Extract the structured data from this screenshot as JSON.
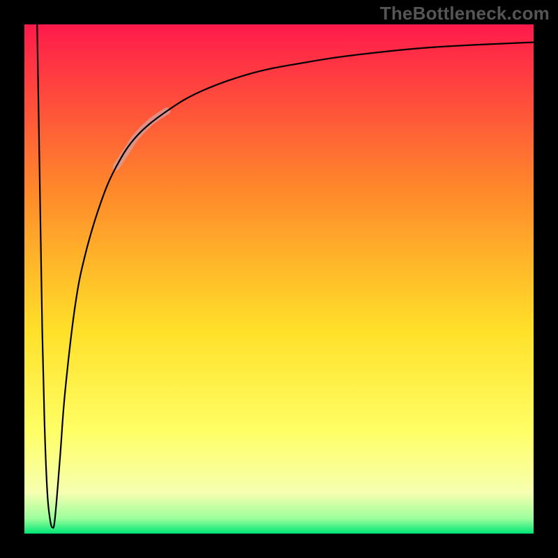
{
  "watermark": "TheBottleneck.com",
  "chart_data": {
    "type": "line",
    "title": "",
    "xlabel": "",
    "ylabel": "",
    "xlim": [
      0,
      100
    ],
    "ylim": [
      0,
      100
    ],
    "background_gradient": {
      "direction": "vertical",
      "stops": [
        {
          "offset": 0.0,
          "color": "#ff1a4b"
        },
        {
          "offset": 0.33,
          "color": "#ff8a2a"
        },
        {
          "offset": 0.6,
          "color": "#ffe029"
        },
        {
          "offset": 0.8,
          "color": "#ffff66"
        },
        {
          "offset": 0.92,
          "color": "#f6ffb0"
        },
        {
          "offset": 0.97,
          "color": "#9cff9c"
        },
        {
          "offset": 1.0,
          "color": "#00e676"
        }
      ]
    },
    "series": [
      {
        "name": "bottleneck-curve",
        "color": "#000000",
        "stroke_width": 2.2,
        "points": [
          {
            "x": 2.5,
            "y": 100.0
          },
          {
            "x": 3.0,
            "y": 70.0
          },
          {
            "x": 3.5,
            "y": 40.0
          },
          {
            "x": 4.0,
            "y": 20.0
          },
          {
            "x": 4.5,
            "y": 8.0
          },
          {
            "x": 5.0,
            "y": 3.0
          },
          {
            "x": 5.5,
            "y": 1.2
          },
          {
            "x": 6.0,
            "y": 3.0
          },
          {
            "x": 7.0,
            "y": 15.0
          },
          {
            "x": 8.0,
            "y": 28.0
          },
          {
            "x": 10.0,
            "y": 45.0
          },
          {
            "x": 12.0,
            "y": 55.0
          },
          {
            "x": 15.0,
            "y": 65.0
          },
          {
            "x": 18.0,
            "y": 72.0
          },
          {
            "x": 22.0,
            "y": 78.0
          },
          {
            "x": 28.0,
            "y": 83.0
          },
          {
            "x": 35.0,
            "y": 87.0
          },
          {
            "x": 45.0,
            "y": 90.5
          },
          {
            "x": 55.0,
            "y": 92.5
          },
          {
            "x": 65.0,
            "y": 94.0
          },
          {
            "x": 80.0,
            "y": 95.5
          },
          {
            "x": 100.0,
            "y": 96.5
          }
        ]
      },
      {
        "name": "highlight-band",
        "color": "#d4a0a0",
        "stroke_width": 10,
        "opacity": 0.75,
        "points": [
          {
            "x": 18.0,
            "y": 72.0
          },
          {
            "x": 20.0,
            "y": 75.0
          },
          {
            "x": 22.0,
            "y": 78.0
          },
          {
            "x": 25.0,
            "y": 81.0
          },
          {
            "x": 28.0,
            "y": 83.0
          }
        ]
      }
    ],
    "annotations": []
  }
}
